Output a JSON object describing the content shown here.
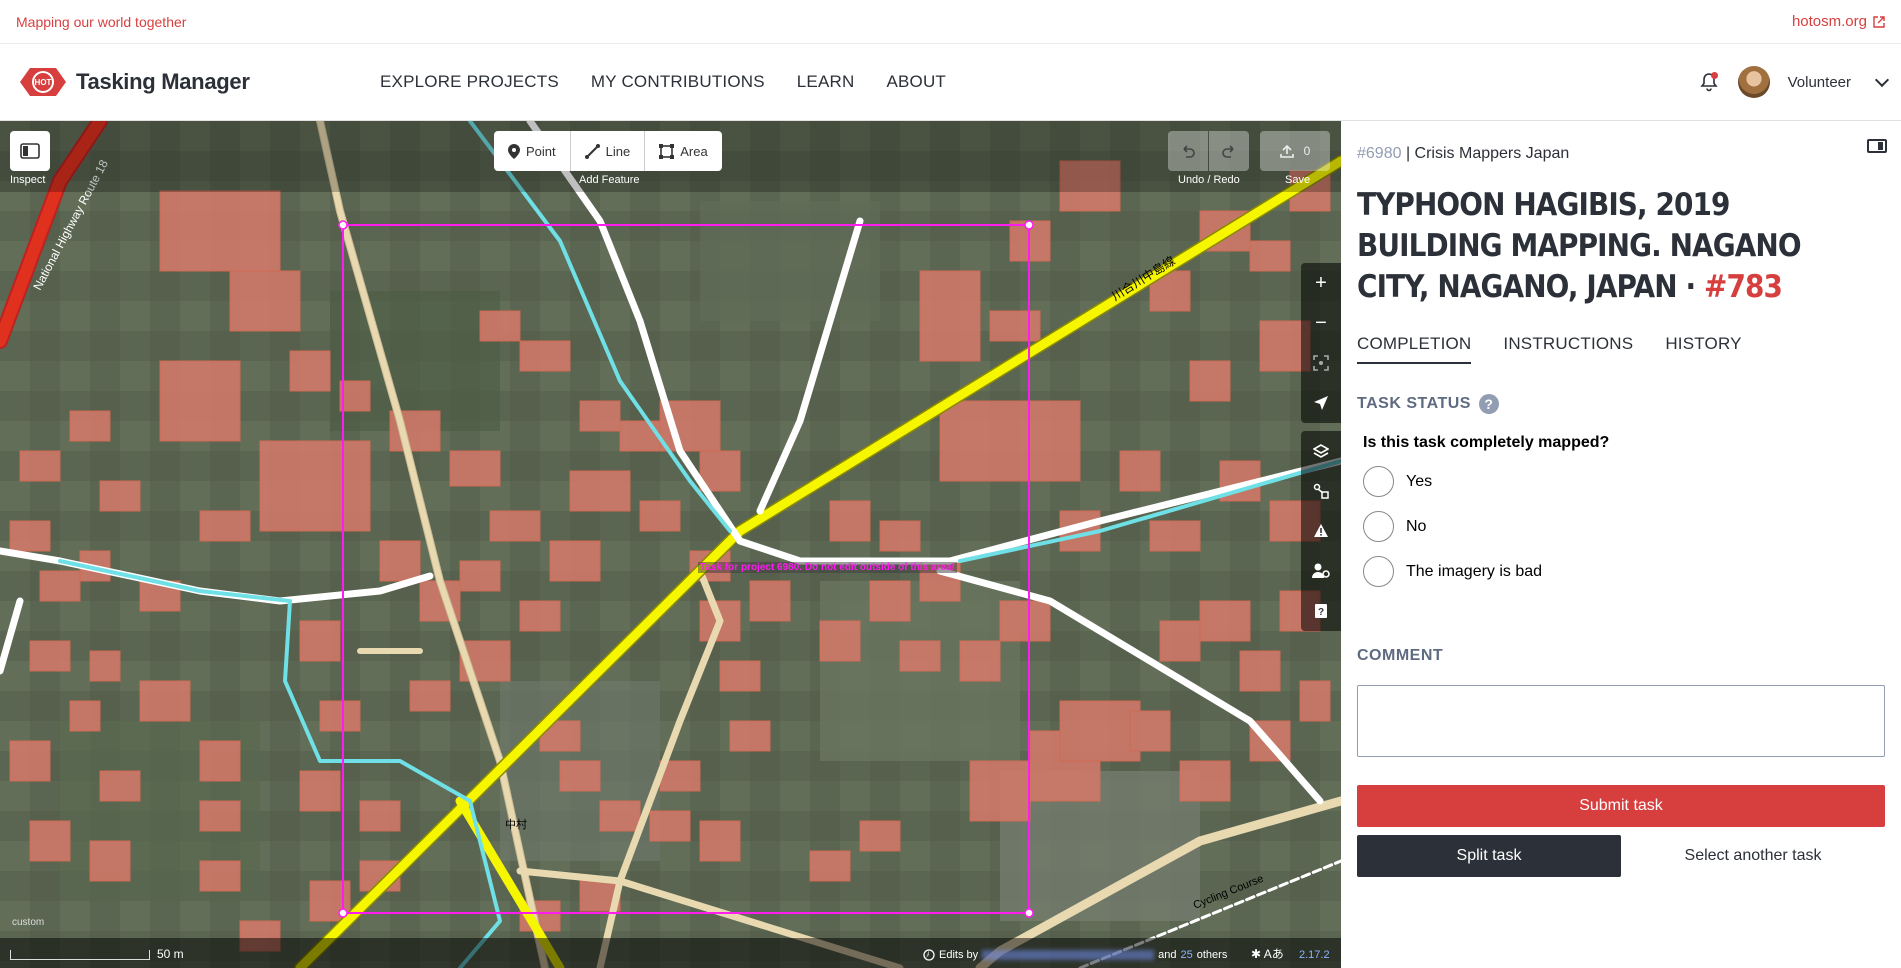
{
  "top": {
    "tagline": "Mapping our world together",
    "hotlink": "hotosm.org"
  },
  "header": {
    "logo_badge": "HOT",
    "logo_text": "Tasking Manager",
    "nav": [
      "EXPLORE PROJECTS",
      "MY CONTRIBUTIONS",
      "LEARN",
      "ABOUT"
    ],
    "user": "Volunteer"
  },
  "map": {
    "inspect": "Inspect",
    "add_feature": {
      "label": "Add Feature",
      "point": "Point",
      "line": "Line",
      "area": "Area"
    },
    "undo_redo": "Undo / Redo",
    "save": "Save",
    "save_count": "0",
    "task_label": "Task for project 6980. Do not edit outside of this area!",
    "road_labels": [
      "National Highway Route 18",
      "川合川中島線",
      "Cycling Course",
      "中村"
    ],
    "scale": "50 m",
    "custom": "custom",
    "edits_prefix": "Edits by",
    "edits_mid": "and",
    "edits_count": "25",
    "edits_suffix": "others",
    "language": "Â",
    "version": "2.17.2"
  },
  "side": {
    "project_id": "#6980",
    "project_sep": " | ",
    "org": "Crisis Mappers Japan",
    "title": "TYPHOON HAGIBIS, 2019 BUILDING MAPPING. NAGANO CITY, NAGANO, JAPAN · ",
    "task_num": "#783",
    "tabs": [
      "COMPLETION",
      "INSTRUCTIONS",
      "HISTORY"
    ],
    "status_header": "TASK STATUS",
    "question": "Is this task completely mapped?",
    "options": [
      "Yes",
      "No",
      "The imagery is bad"
    ],
    "comment_header": "COMMENT",
    "submit": "Submit task",
    "split": "Split task",
    "another": "Select another task"
  },
  "colors": {
    "accent": "#d73f3f",
    "dark": "#2c3038",
    "task_border": "#ff1cf0",
    "highway": "#ffff00"
  }
}
